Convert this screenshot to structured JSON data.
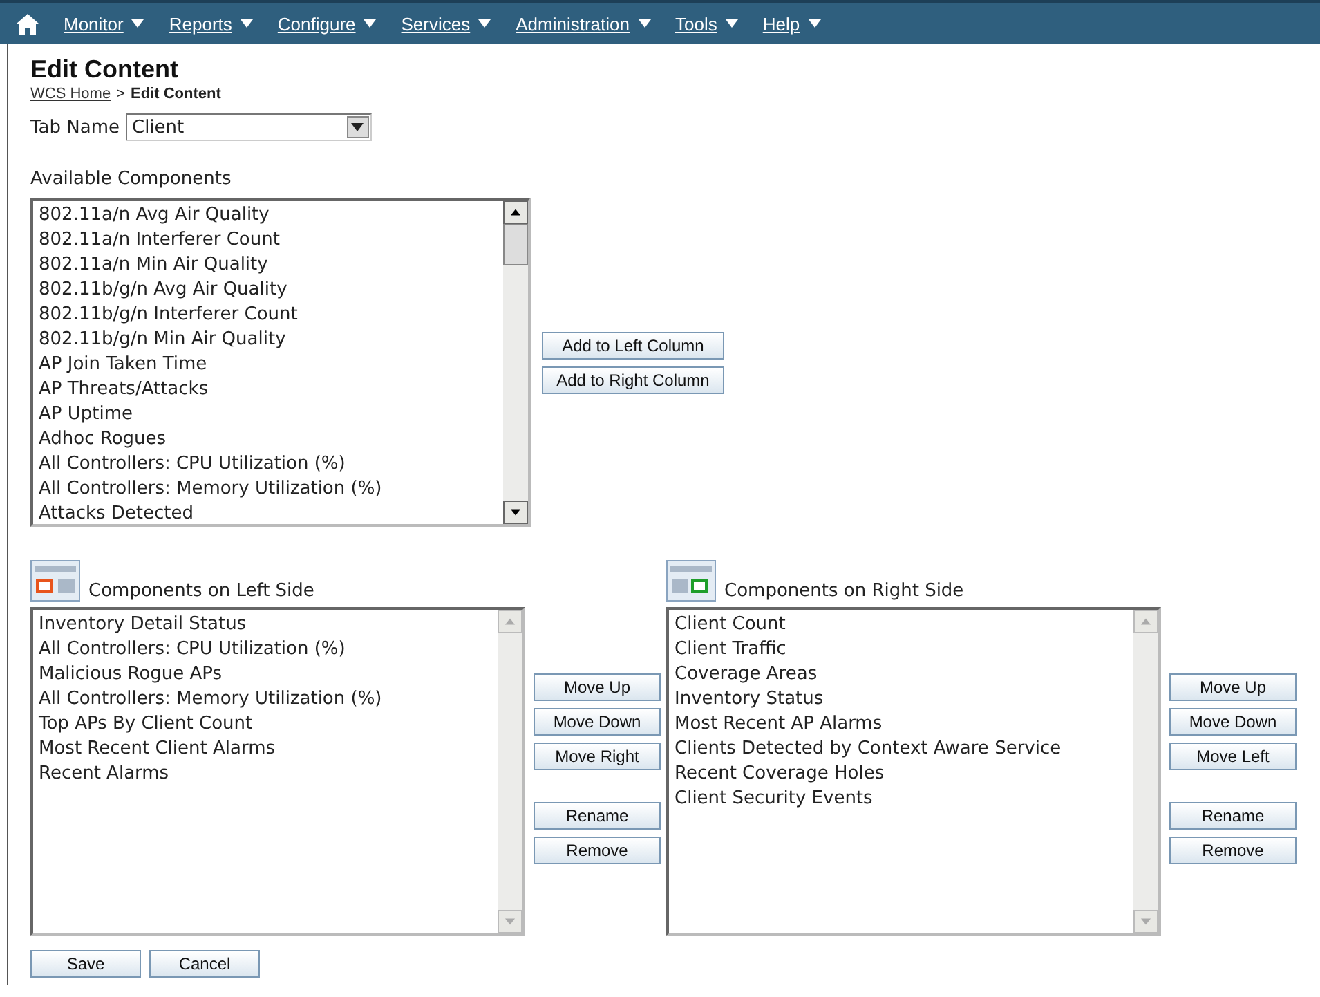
{
  "menu": [
    {
      "label": "Monitor"
    },
    {
      "label": "Reports"
    },
    {
      "label": "Configure"
    },
    {
      "label": "Services"
    },
    {
      "label": "Administration"
    },
    {
      "label": "Tools"
    },
    {
      "label": "Help"
    }
  ],
  "title": "Edit Content",
  "breadcrumb": {
    "link": "WCS Home",
    "separator": ">",
    "current": "Edit Content"
  },
  "tab_name": {
    "label": "Tab Name",
    "value": "Client"
  },
  "available": {
    "label": "Available Components",
    "items": [
      "802.11a/n Avg Air Quality",
      "802.11a/n Interferer Count",
      "802.11a/n Min Air Quality",
      "802.11b/g/n Avg Air Quality",
      "802.11b/g/n Interferer Count",
      "802.11b/g/n Min Air Quality",
      "AP Join Taken Time",
      "AP Threats/Attacks",
      "AP Uptime",
      "Adhoc Rogues",
      "All Controllers: CPU Utilization (%)",
      "All Controllers: Memory Utilization (%)",
      "Attacks Detected"
    ],
    "buttons": [
      "Add to Left Column",
      "Add to Right Column"
    ]
  },
  "panels": [
    {
      "kind": "left",
      "label": "Components on Left Side",
      "items": [
        "Inventory Detail Status",
        "All Controllers: CPU Utilization (%)",
        "Malicious Rogue APs",
        "All Controllers: Memory Utilization (%)",
        "Top APs By Client Count",
        "Most Recent Client Alarms",
        "Recent Alarms"
      ],
      "move_buttons": [
        "Move Up",
        "Move Down",
        "Move Right"
      ],
      "edit_buttons": [
        "Rename",
        "Remove"
      ]
    },
    {
      "kind": "right",
      "label": "Components on Right Side",
      "items": [
        "Client Count",
        "Client Traffic",
        "Coverage Areas",
        "Inventory Status",
        "Most Recent AP Alarms",
        "Clients Detected by Context Aware Service",
        "Recent Coverage Holes",
        "Client Security Events"
      ],
      "move_buttons": [
        "Move Up",
        "Move Down",
        "Move Left"
      ],
      "edit_buttons": [
        "Rename",
        "Remove"
      ]
    }
  ],
  "footer_buttons": [
    "Save",
    "Cancel"
  ]
}
